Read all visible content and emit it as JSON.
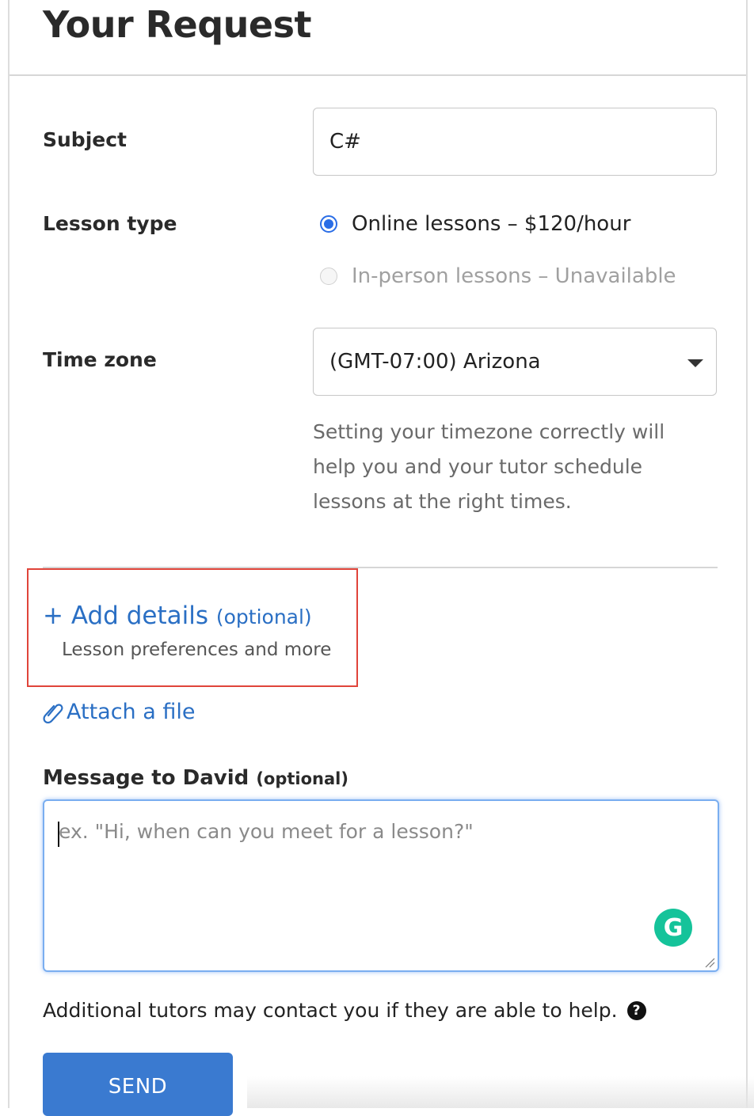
{
  "page": {
    "title": "Your Request"
  },
  "subject": {
    "label": "Subject",
    "value": "C#"
  },
  "lesson_type": {
    "label": "Lesson type",
    "options": [
      {
        "label": "Online lessons – $120/hour",
        "checked": true,
        "disabled": false
      },
      {
        "label": "In-person lessons – Unavailable",
        "checked": false,
        "disabled": true
      }
    ]
  },
  "time_zone": {
    "label": "Time zone",
    "value": "(GMT-07:00) Arizona",
    "help": "Setting your timezone correctly will help you and your tutor schedule lessons at the right times."
  },
  "add_details": {
    "plus": "+",
    "label": "Add details",
    "optional": "(optional)",
    "sub": "Lesson preferences and more"
  },
  "attach": {
    "icon": "paperclip-icon",
    "label": "Attach a file"
  },
  "message": {
    "label": "Message to David",
    "optional": "(optional)",
    "placeholder": "ex. \"Hi, when can you meet for a lesson?\""
  },
  "grammarly": {
    "glyph": "G"
  },
  "footer": {
    "note": "Additional tutors may contact you if they are able to help.",
    "help_glyph": "?",
    "send_label": "SEND"
  },
  "colors": {
    "link": "#2a6fc4",
    "radio_checked": "#2a6de6",
    "highlight": "#e0443a",
    "send_button": "#3a7ad0",
    "grammarly": "#15c39a"
  }
}
